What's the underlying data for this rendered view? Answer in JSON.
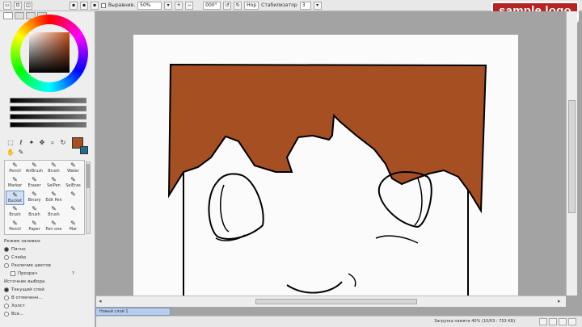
{
  "toolbar": {
    "antialias_label": "Выравнив.",
    "zoom_value": "50%",
    "rotation_value": "000°",
    "flip_label": "Нор",
    "stabilizer_label": "Стабилизатор",
    "stabilizer_value": "3"
  },
  "logo": {
    "text": "sample logo"
  },
  "colors": {
    "hair": "#a54f23",
    "primary_swatch": "#a54f23",
    "secondary_swatch": "#1d6f8c"
  },
  "brushes": [
    {
      "label": "Pencil"
    },
    {
      "label": "AirBrush"
    },
    {
      "label": "Brush"
    },
    {
      "label": "Water"
    },
    {
      "label": "Marker"
    },
    {
      "label": "Eraser"
    },
    {
      "label": "SelPen"
    },
    {
      "label": "SelEras"
    },
    {
      "label": "Bucket"
    },
    {
      "label": "Binary"
    },
    {
      "label": "Edit Pen"
    },
    {
      "label": ""
    },
    {
      "label": "Brush"
    },
    {
      "label": "Brush"
    },
    {
      "label": "Brush"
    },
    {
      "label": ""
    },
    {
      "label": "Pencil"
    },
    {
      "label": "Paper"
    },
    {
      "label": "Pen one"
    },
    {
      "label": "Mar"
    }
  ],
  "options": {
    "fill_mode_label": "Режим заливки",
    "fill_opt1": "Пятно",
    "fill_opt2": "Слайд",
    "diff_label": "Различие цветов",
    "diff_value": "Прозрач",
    "source_label": "Источник выбора",
    "source_opt1": "Текущий слой",
    "source_opt2": "В отмеченн...",
    "source_opt3": "Холст",
    "source_opt4": "Все..."
  },
  "layer": {
    "name": "Новый слой 1"
  },
  "status": {
    "text": "Загрузка памяти 40% (10/03 : 753 КБ)"
  }
}
